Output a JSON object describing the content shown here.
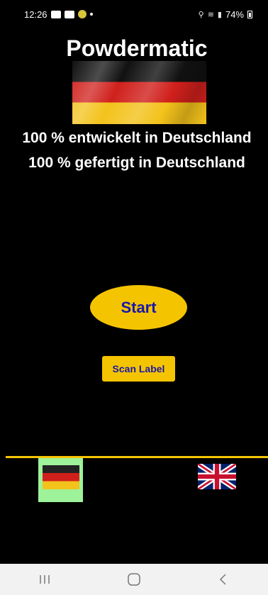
{
  "status_bar": {
    "time": "12:26",
    "battery": "74%"
  },
  "app": {
    "title": "Powdermatic",
    "made_line1": "100 % entwickelt in Deutschland",
    "made_line2": "100 % gefertigt in Deutschland",
    "start_label": "Start",
    "scan_label": "Scan Label",
    "languages": [
      {
        "code": "de",
        "selected": true,
        "icon": "german-flag-icon"
      },
      {
        "code": "en",
        "selected": false,
        "icon": "uk-flag-icon"
      }
    ],
    "colors": {
      "accent": "#f5c400",
      "button_text": "#1818a8",
      "selected_language_bg": "#9ef29a",
      "background": "#000000"
    }
  },
  "nav_bar": {
    "icons": [
      "recent-apps-icon",
      "home-icon",
      "back-icon"
    ]
  }
}
